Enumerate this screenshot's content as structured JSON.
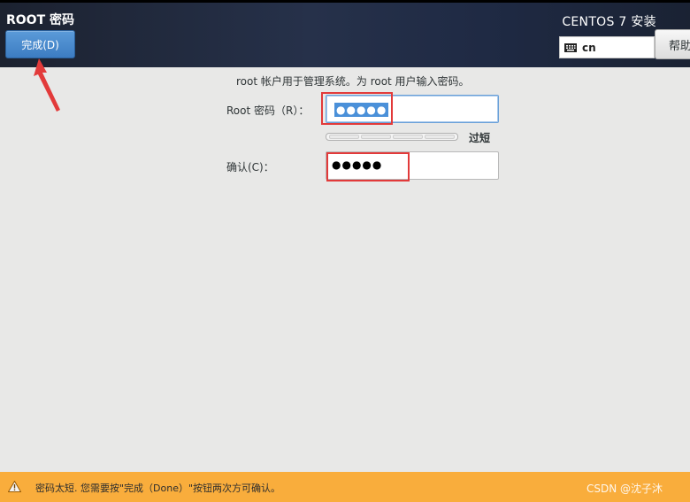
{
  "header": {
    "title": "ROOT 密码",
    "done_label": "完成(D)",
    "product_title": "CENTOS 7 安装",
    "keyboard_layout": "cn",
    "help_label": "帮助"
  },
  "form": {
    "instruction": "root 帐户用于管理系统。为 root 用户输入密码。",
    "password_label": "Root 密码（R）：",
    "password_value": "●●●●●",
    "strength_label": "过短",
    "confirm_label": "确认(C)：",
    "confirm_value": "●●●●●"
  },
  "footer": {
    "warning_text": "密码太短. 您需要按\"完成（Done）\"按钮两次方可确认。",
    "watermark": "CSDN @沈子沐"
  },
  "colors": {
    "accent": "#3c7cc2",
    "warning": "#f9ad3c",
    "annotation": "#e23a3a"
  }
}
